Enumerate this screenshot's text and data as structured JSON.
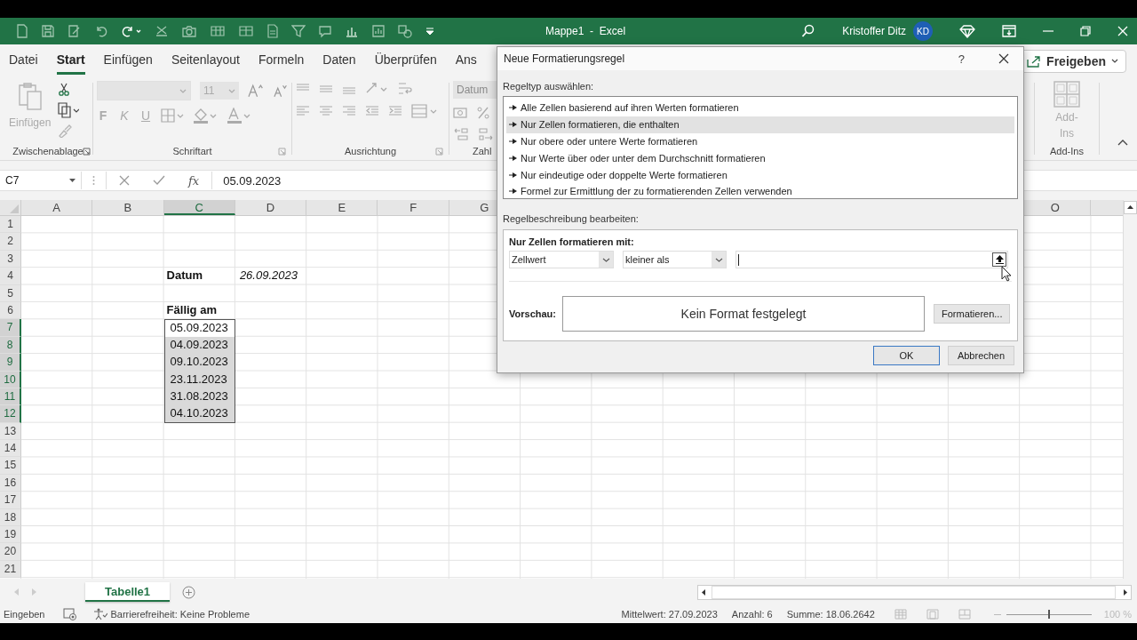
{
  "title_bar": {
    "title": "Mappe1  -  Excel",
    "user": "Kristoffer Ditz",
    "avatar": "KD"
  },
  "ribbon_tabs": [
    {
      "label": "Datei",
      "selected": false
    },
    {
      "label": "Start",
      "selected": true
    },
    {
      "label": "Einfügen",
      "selected": false
    },
    {
      "label": "Seitenlayout",
      "selected": false
    },
    {
      "label": "Formeln",
      "selected": false
    },
    {
      "label": "Daten",
      "selected": false
    },
    {
      "label": "Überprüfen",
      "selected": false
    },
    {
      "label": "Ans",
      "selected": false
    }
  ],
  "share_button": "Freigeben",
  "ribbon": {
    "paste_label": "Einfügen",
    "font_size": "11",
    "format_buttons": [
      "F",
      "K",
      "U"
    ],
    "number_format": "Datum",
    "addins_label": "Add-Ins",
    "groups": [
      "Zwischenablage",
      "Schriftart",
      "Ausrichtung",
      "Zahl",
      "Add-Ins"
    ]
  },
  "formula_bar": {
    "name_box": "C7",
    "function_label": "fx",
    "formula": "05.09.2023"
  },
  "sheet": {
    "columns": [
      {
        "label": "A",
        "selected": false
      },
      {
        "label": "B",
        "selected": false
      },
      {
        "label": "C",
        "selected": true
      },
      {
        "label": "D",
        "selected": false
      },
      {
        "label": "E",
        "selected": false
      },
      {
        "label": "F",
        "selected": false
      },
      {
        "label": "G",
        "selected": false
      }
    ],
    "columns_right": [
      {
        "label": "O",
        "selected": false
      }
    ],
    "rows": [
      {
        "number": "1",
        "selected": false
      },
      {
        "number": "2",
        "selected": false
      },
      {
        "number": "3",
        "selected": false
      },
      {
        "number": "4",
        "selected": false,
        "cells": {
          "C": {
            "text": "Datum",
            "kind": "bold",
            "selected": false
          },
          "D": {
            "text": "26.09.2023",
            "kind": "italic",
            "selected": false
          }
        }
      },
      {
        "number": "5",
        "selected": false
      },
      {
        "number": "6",
        "selected": false,
        "cells": {
          "C": {
            "text": "Fällig am",
            "kind": "bold",
            "selected": false
          }
        }
      },
      {
        "number": "7",
        "selected": true,
        "cells": {
          "C": {
            "text": "05.09.2023",
            "kind": "plain",
            "selected": true
          }
        }
      },
      {
        "number": "8",
        "selected": true,
        "cells": {
          "C": {
            "text": "04.09.2023",
            "kind": "plain",
            "selected": true
          }
        }
      },
      {
        "number": "9",
        "selected": true,
        "cells": {
          "C": {
            "text": "09.10.2023",
            "kind": "plain",
            "selected": true
          }
        }
      },
      {
        "number": "10",
        "selected": true,
        "cells": {
          "C": {
            "text": "23.11.2023",
            "kind": "plain",
            "selected": true
          }
        }
      },
      {
        "number": "11",
        "selected": true,
        "cells": {
          "C": {
            "text": "31.08.2023",
            "kind": "plain",
            "selected": true
          }
        }
      },
      {
        "number": "12",
        "selected": true,
        "cells": {
          "C": {
            "text": "04.10.2023",
            "kind": "plain",
            "selected": true
          }
        }
      },
      {
        "number": "13",
        "selected": false
      },
      {
        "number": "14",
        "selected": false
      },
      {
        "number": "15",
        "selected": false
      },
      {
        "number": "16",
        "selected": false
      },
      {
        "number": "17",
        "selected": false
      },
      {
        "number": "18",
        "selected": false
      },
      {
        "number": "19",
        "selected": false
      },
      {
        "number": "20",
        "selected": false
      },
      {
        "number": "21",
        "selected": false
      }
    ]
  },
  "sheet_tabs": [
    {
      "label": "Tabelle1",
      "selected": true
    }
  ],
  "status_bar": {
    "mode": "Eingeben",
    "accessibility": "Barrierefreiheit: Keine Probleme",
    "stats": [
      "Mittelwert: 27.09.2023",
      "Anzahl: 6",
      "Summe: 18.06.2642"
    ],
    "zoom_slider": {
      "level": 0.5
    },
    "zoom": "100 %"
  },
  "dialog": {
    "title": "Neue Formatierungsregel",
    "help": "?",
    "rule_type_label": "Regeltyp auswählen:",
    "rule_types": [
      {
        "label": "Alle Zellen basierend auf ihren Werten formatieren",
        "selected": false
      },
      {
        "label": "Nur Zellen formatieren, die enthalten",
        "selected": true
      },
      {
        "label": "Nur obere oder untere Werte formatieren",
        "selected": false
      },
      {
        "label": "Nur Werte über oder unter dem Durchschnitt formatieren",
        "selected": false
      },
      {
        "label": "Nur eindeutige oder doppelte Werte formatieren",
        "selected": false
      },
      {
        "label": "Formel zur Ermittlung der zu formatierenden Zellen verwenden",
        "selected": false
      }
    ],
    "description_label": "Regelbeschreibung bearbeiten:",
    "condition_heading": "Nur Zellen formatieren mit:",
    "condition_field": "Zellwert",
    "operator": "kleiner als",
    "preview_label": "Vorschau:",
    "preview_text": "Kein Format festgelegt",
    "format_button": "Formatieren...",
    "buttons": [
      "OK",
      "Abbrechen"
    ]
  }
}
